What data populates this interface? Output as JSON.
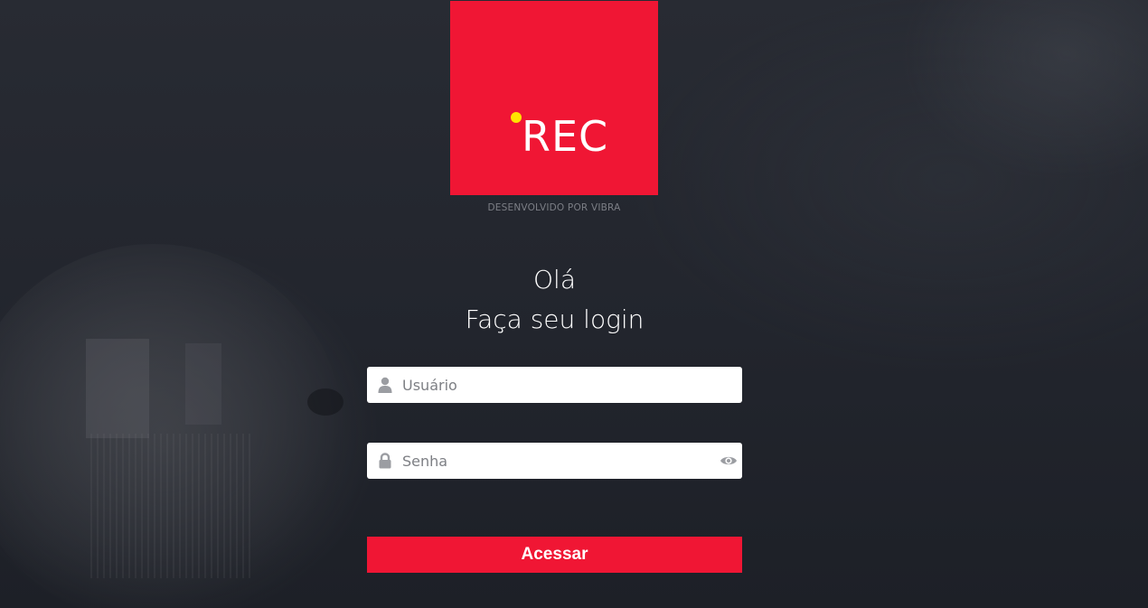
{
  "brand": {
    "logo_text": "REC",
    "credit": "DESENVOLVIDO POR VIBRA",
    "logo_color": "#f01634",
    "dot_color": "#ffe400"
  },
  "greeting": {
    "line1": "Olá",
    "line2": "Faça seu login"
  },
  "form": {
    "username": {
      "placeholder": "Usuário",
      "value": "",
      "icon": "user-icon"
    },
    "password": {
      "placeholder": "Senha",
      "value": "",
      "icon": "lock-icon",
      "toggle_icon": "eye-icon"
    },
    "submit_label": "Acessar"
  },
  "colors": {
    "background": "#23262e",
    "accent": "#f01634",
    "text": "#ffffff"
  }
}
